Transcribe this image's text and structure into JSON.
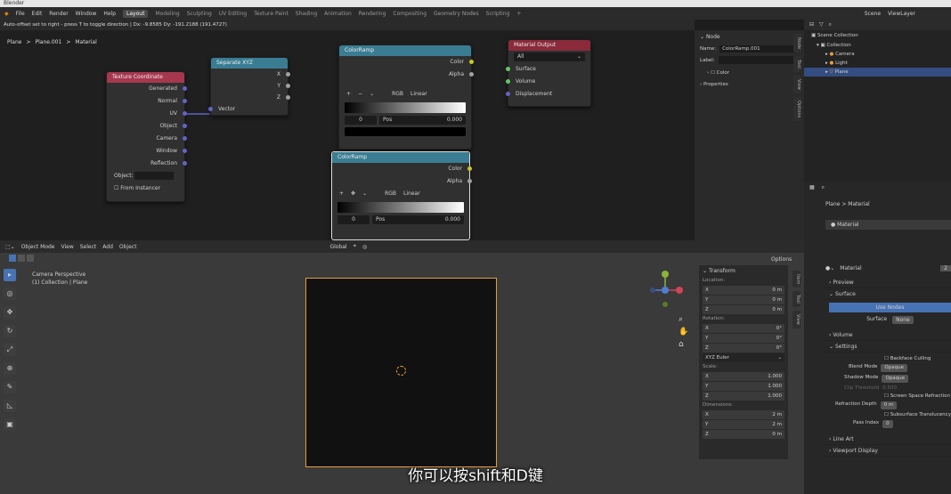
{
  "window": {
    "title": "Blender"
  },
  "menu": {
    "items": [
      "File",
      "Edit",
      "Render",
      "Window",
      "Help"
    ],
    "workspaces": [
      "Layout",
      "Modeling",
      "Sculpting",
      "UV Editing",
      "Texture Paint",
      "Shading",
      "Animation",
      "Rendering",
      "Compositing",
      "Geometry Nodes",
      "Scripting"
    ],
    "active": "Layout",
    "scene": "Scene",
    "viewlayer": "ViewLayer"
  },
  "status": "Auto-offset set to right - press T to toggle direction | Dx: -9.8585   Dy: -191.2188 (191.4727)",
  "breadcrumb": [
    "Plane",
    ">",
    "Plane.001",
    ">",
    "Material"
  ],
  "nodes": {
    "texcoord": {
      "title": "Texture Coordinate",
      "outputs": [
        "Generated",
        "Normal",
        "UV",
        "Object",
        "Camera",
        "Window",
        "Reflection"
      ],
      "object_label": "Object:",
      "instancer": "From Instancer"
    },
    "separate": {
      "title": "Separate XYZ",
      "outputs": [
        "X",
        "Y",
        "Z"
      ],
      "input": "Vector"
    },
    "ramp1": {
      "title": "ColorRamp",
      "outputs": [
        "Color",
        "Alpha"
      ],
      "mode": "RGB",
      "interp": "Linear",
      "idx": "0",
      "pos_label": "Pos",
      "pos": "0.000"
    },
    "ramp2": {
      "title": "ColorRamp",
      "outputs": [
        "Color",
        "Alpha"
      ],
      "mode": "RGB",
      "interp": "Linear",
      "idx": "0",
      "pos_label": "Pos",
      "pos": "0.000"
    },
    "matout": {
      "title": "Material Output",
      "target": "All",
      "inputs": [
        "Surface",
        "Volume",
        "Displacement"
      ]
    }
  },
  "nodepanel": {
    "header": "Node",
    "name_label": "Name:",
    "name": "ColorRamp.001",
    "label_label": "Label:",
    "color": "Color",
    "properties": "Properties",
    "tabs": [
      "Node",
      "Tool",
      "View",
      "Options"
    ]
  },
  "outliner": {
    "root": "Scene Collection",
    "items": [
      "Collection",
      "Camera",
      "Light",
      "Plane"
    ]
  },
  "viewport": {
    "mode": "Object Mode",
    "menus": [
      "View",
      "Select",
      "Add",
      "Object"
    ],
    "info1": "Camera Perspective",
    "info2": "(1) Collection | Plane",
    "orientation": "Global",
    "options": "Options"
  },
  "transform": {
    "header": "Transform",
    "location": "Location:",
    "rotation": "Rotation:",
    "scale": "Scale:",
    "dimensions": "Dimensions:",
    "loc": [
      "0 m",
      "0 m",
      "0 m"
    ],
    "rot": [
      "0°",
      "0°",
      "0°"
    ],
    "euler": "XYZ Euler",
    "scl": [
      "1.000",
      "1.000",
      "1.000"
    ],
    "dim": [
      "2 m",
      "2 m",
      "0 m"
    ],
    "axes": [
      "X",
      "Y",
      "Z"
    ],
    "tabs": [
      "Item",
      "Tool",
      "View"
    ]
  },
  "props": {
    "breadcrumb": "Plane > Material",
    "slot": "Material",
    "mat_name": "Material",
    "users": "2",
    "sections": [
      "Preview",
      "Surface"
    ],
    "use_nodes": "Use Nodes",
    "surface_label": "Surface",
    "surface_value": "None",
    "volume": "Volume",
    "settings": "Settings",
    "backface": "Backface Culling",
    "blend_label": "Blend Mode",
    "blend": "Opaque",
    "shadow_label": "Shadow Mode",
    "shadow": "Opaque",
    "clip_label": "Clip Threshold",
    "clip": "0.500",
    "ssr": "Screen Space Refraction",
    "refr_label": "Refraction Depth",
    "refr": "0 m",
    "sst": "Subsurface Translucency",
    "pass_label": "Pass Index",
    "pass": "0",
    "lineart": "Line Art",
    "vpdisplay": "Viewport Display"
  },
  "subtitle": "你可以按shift和D键",
  "colors": {
    "texcoord_header": "#a6374f",
    "separate_header": "#3a7d93",
    "ramp_header": "#3a7d93",
    "matout_header": "#8a2a3a",
    "selection": "#e89d3a"
  }
}
